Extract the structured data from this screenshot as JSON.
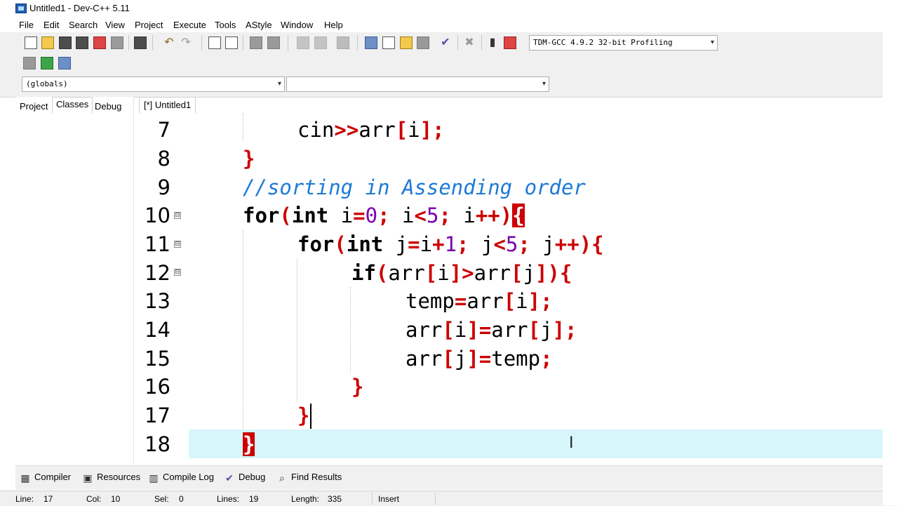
{
  "window": {
    "title": "Untitled1 - Dev-C++ 5.11"
  },
  "menu": [
    "File",
    "Edit",
    "Search",
    "View",
    "Project",
    "Execute",
    "Tools",
    "AStyle",
    "Window",
    "Help"
  ],
  "toolbar": {
    "compiler_select": "TDM-GCC 4.9.2 32-bit Profiling",
    "scope_select": "(globals)",
    "member_select": ""
  },
  "left_panel": {
    "tabs": [
      "Project",
      "Classes",
      "Debug"
    ],
    "active_tab": "Classes"
  },
  "editor_tab": "[*] Untitled1",
  "editor": {
    "lines": [
      {
        "number": "7",
        "fold": ""
      },
      {
        "number": "8",
        "fold": ""
      },
      {
        "number": "9",
        "fold": ""
      },
      {
        "number": "10",
        "fold": "⊟"
      },
      {
        "number": "11",
        "fold": "⊟"
      },
      {
        "number": "12",
        "fold": "⊟"
      },
      {
        "number": "13",
        "fold": ""
      },
      {
        "number": "14",
        "fold": ""
      },
      {
        "number": "15",
        "fold": ""
      },
      {
        "number": "16",
        "fold": ""
      },
      {
        "number": "17",
        "fold": ""
      },
      {
        "number": "18",
        "fold": ""
      }
    ],
    "code": {
      "l7": [
        "cin",
        ">>",
        "arr",
        "[",
        "i",
        "];"
      ],
      "l8": [
        "}"
      ],
      "l9": [
        "//sorting in Assending order"
      ],
      "l10": [
        "for",
        "(",
        "int",
        " i",
        "=",
        "0",
        ";",
        " i",
        "<",
        "5",
        ";",
        " i",
        "++",
        ")",
        "{"
      ],
      "l11": [
        "for",
        "(",
        "int",
        " j",
        "=",
        "i",
        "+",
        "1",
        ";",
        " j",
        "<",
        "5",
        ";",
        " j",
        "++",
        "){"
      ],
      "l12": [
        "if",
        "(",
        "arr",
        "[",
        "i",
        "]>",
        "arr",
        "[",
        "j",
        "]){"
      ],
      "l13": [
        "temp",
        "=",
        "arr",
        "[",
        "i",
        "];"
      ],
      "l14": [
        "arr",
        "[",
        "i",
        "]=",
        "arr",
        "[",
        "j",
        "];"
      ],
      "l15": [
        "arr",
        "[",
        "j",
        "]=",
        "temp",
        ";"
      ],
      "l16": [
        "}"
      ],
      "l17": [
        "}"
      ],
      "l18": [
        "}"
      ]
    },
    "colors": {
      "keyword": "#000000",
      "punct": "#cc0000",
      "number": "#7a00b0",
      "comment": "#1d7ad6",
      "current_line": "#d6f6fb"
    }
  },
  "bottom_tabs": [
    {
      "label": "Compiler",
      "icon": "grid-icon"
    },
    {
      "label": "Resources",
      "icon": "resources-icon"
    },
    {
      "label": "Compile Log",
      "icon": "chart-icon"
    },
    {
      "label": "Debug",
      "icon": "check-icon"
    },
    {
      "label": "Find Results",
      "icon": "find-icon"
    }
  ],
  "status": {
    "line_label": "Line:",
    "line": "17",
    "col_label": "Col:",
    "col": "10",
    "sel_label": "Sel:",
    "sel": "0",
    "lines_label": "Lines:",
    "lines": "19",
    "length_label": "Length:",
    "length": "335",
    "mode": "Insert"
  }
}
